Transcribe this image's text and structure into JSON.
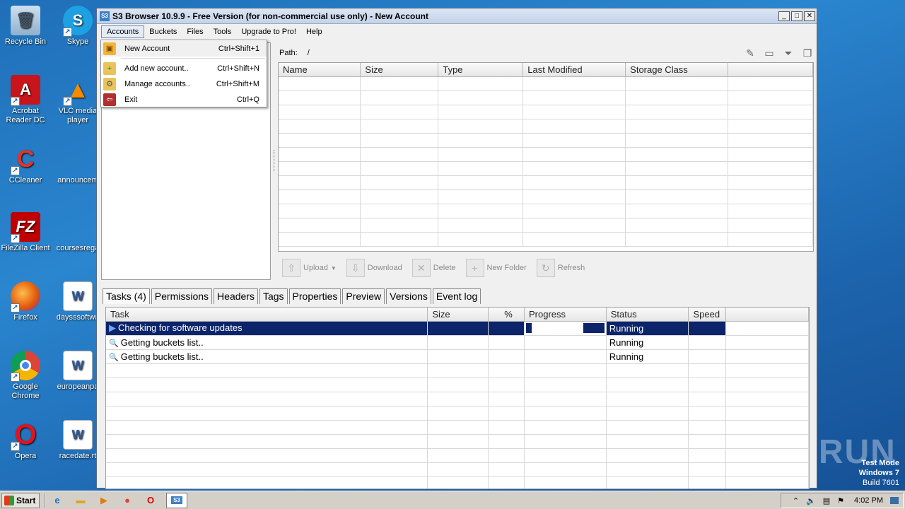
{
  "desktop": {
    "icons": [
      {
        "label": "Recycle Bin"
      },
      {
        "label": "Skype"
      },
      {
        "label": "Acrobat Reader DC"
      },
      {
        "label": "VLC media player"
      },
      {
        "label": "CCleaner"
      },
      {
        "label": "announcem"
      },
      {
        "label": "FileZilla Client"
      },
      {
        "label": "coursesrega"
      },
      {
        "label": "Firefox"
      },
      {
        "label": "daysssoftwa"
      },
      {
        "label": "Google Chrome"
      },
      {
        "label": "europeanpa"
      },
      {
        "label": "Opera"
      },
      {
        "label": "racedate.rt"
      }
    ]
  },
  "window": {
    "title": "S3 Browser 10.9.9 - Free Version (for non-commercial use only) - New Account",
    "app_icon": "S3"
  },
  "menu": [
    "Accounts",
    "Buckets",
    "Files",
    "Tools",
    "Upgrade to Pro!",
    "Help"
  ],
  "accounts_menu": {
    "items": [
      {
        "label": "New Account",
        "shortcut": "Ctrl+Shift+1",
        "icon": "new-account-icon"
      },
      {
        "label": "Add new account..",
        "shortcut": "Ctrl+Shift+N",
        "icon": "add-account-icon"
      },
      {
        "label": "Manage accounts..",
        "shortcut": "Ctrl+Shift+M",
        "icon": "manage-accounts-icon"
      },
      {
        "label": "Exit",
        "shortcut": "Ctrl+Q",
        "icon": "exit-icon"
      }
    ]
  },
  "path": {
    "label": "Path:",
    "value": "/"
  },
  "files_table": {
    "columns": [
      "Name",
      "Size",
      "Type",
      "Last Modified",
      "Storage Class"
    ]
  },
  "toolbar": {
    "upload": "Upload",
    "download": "Download",
    "delete": "Delete",
    "new_folder": "New Folder",
    "refresh": "Refresh"
  },
  "tabs": [
    "Tasks (4)",
    "Permissions",
    "Headers",
    "Tags",
    "Properties",
    "Preview",
    "Versions",
    "Event log"
  ],
  "tasks_table": {
    "columns": [
      "Task",
      "Size",
      "%",
      "Progress",
      "Status",
      "Speed"
    ],
    "rows": [
      {
        "task": "Checking for software updates",
        "size": "",
        "pct": "",
        "status": "Running",
        "speed": "",
        "icon": "play-icon"
      },
      {
        "task": "Getting buckets list..",
        "size": "",
        "pct": "",
        "status": "Running",
        "speed": "",
        "icon": "magnifier-icon"
      },
      {
        "task": "Getting buckets list..",
        "size": "",
        "pct": "",
        "status": "Running",
        "speed": "",
        "icon": "magnifier-icon"
      }
    ]
  },
  "taskbar": {
    "start": "Start",
    "clock": "4:02 PM"
  },
  "watermark": {
    "line1": "Test Mode",
    "line2": "Windows 7",
    "line3": "Build 7601",
    "brand": "ANY RUN"
  },
  "colors": {
    "selection": "#0b246a",
    "desktop": "#1f6fb8"
  }
}
